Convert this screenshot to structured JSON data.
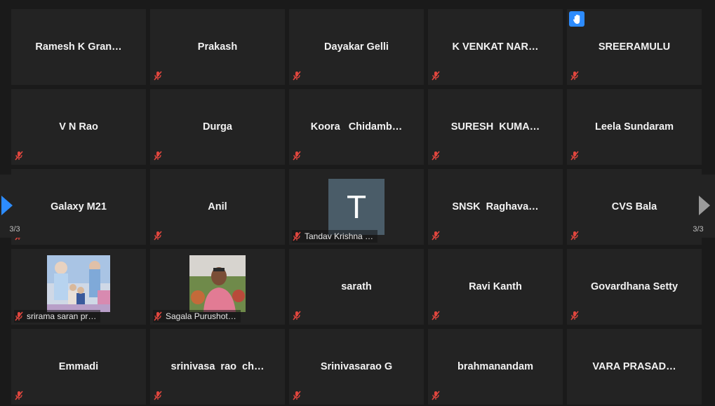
{
  "pagination": {
    "left_label": "3/3",
    "right_label": "3/3"
  },
  "tiles": [
    {
      "name": "Ramesh K Gran…",
      "muted": false
    },
    {
      "name": "Prakash",
      "muted": true
    },
    {
      "name": "Dayakar Gelli",
      "muted": true
    },
    {
      "name": "K VENKAT NAR…",
      "muted": true
    },
    {
      "name": "SREERAMULU",
      "muted": true,
      "hand_raised": true
    },
    {
      "name": "V N Rao",
      "muted": true
    },
    {
      "name": "Durga",
      "muted": true
    },
    {
      "name": "Koora   Chidamb…",
      "muted": true
    },
    {
      "name": "SURESH  KUMA…",
      "muted": true
    },
    {
      "name": "Leela Sundaram",
      "muted": true
    },
    {
      "name": "Galaxy M21",
      "muted": true
    },
    {
      "name": "Anil",
      "muted": true
    },
    {
      "name": "Tandav Krishna …",
      "muted": true,
      "avatar_letter": "T"
    },
    {
      "name": "SNSK  Raghava…",
      "muted": true
    },
    {
      "name": "CVS Bala",
      "muted": true
    },
    {
      "name": "srirama saran pr…",
      "muted": true,
      "photo": "kids-photo"
    },
    {
      "name": "Sagala Purushot…",
      "muted": true,
      "photo": "man-photo"
    },
    {
      "name": "sarath",
      "muted": true
    },
    {
      "name": "Ravi Kanth",
      "muted": true
    },
    {
      "name": "Govardhana Setty",
      "muted": true
    },
    {
      "name": "Emmadi",
      "muted": true
    },
    {
      "name": "srinivasa  rao  ch…",
      "muted": true
    },
    {
      "name": "Srinivasarao G",
      "muted": true
    },
    {
      "name": "brahmanandam",
      "muted": true
    },
    {
      "name": "VARA PRASAD…",
      "muted": false
    }
  ],
  "colors": {
    "background": "#1a1a1a",
    "tile": "#232323",
    "mute_icon": "#e0463e",
    "hand_badge": "#2d8cff",
    "nav_arrow_left": "#2d8cff",
    "nav_arrow_right": "#9a9a9a",
    "avatar_bg": "#4a5c68"
  }
}
